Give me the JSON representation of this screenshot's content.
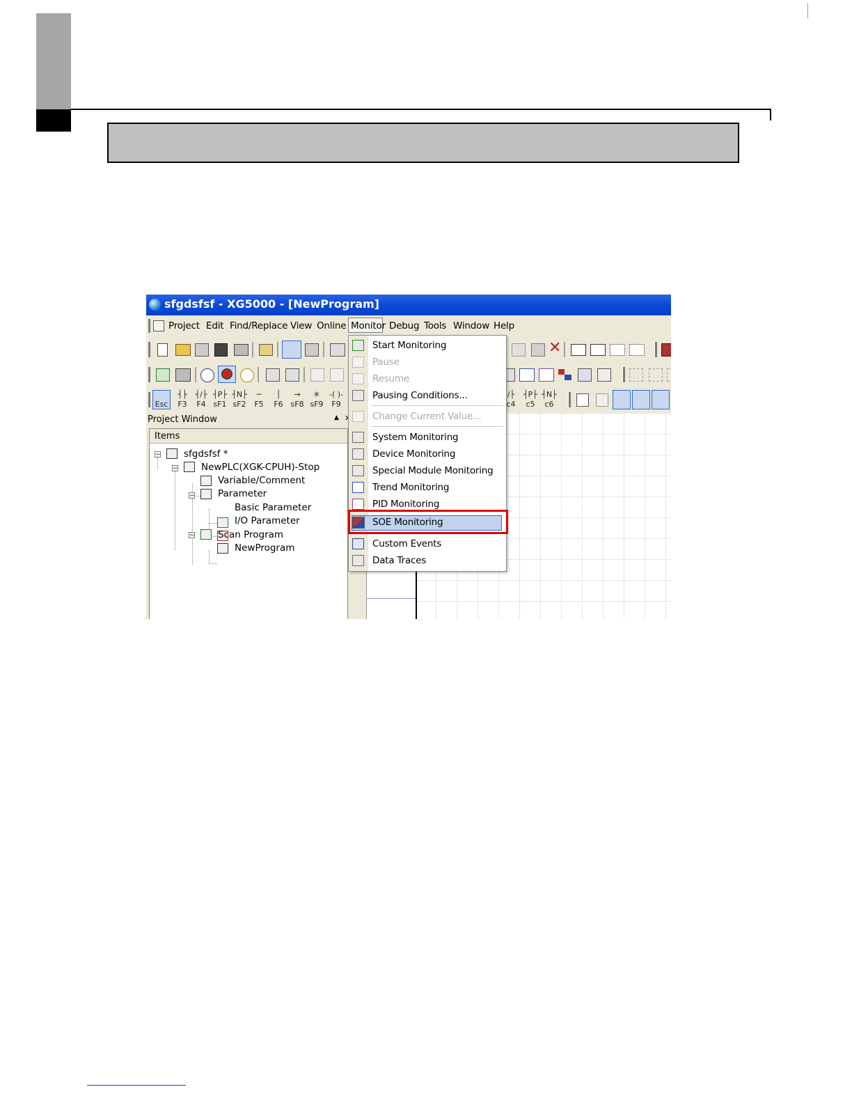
{
  "window": {
    "title": "sfgdsfsf - XG5000 - [NewProgram]"
  },
  "menubar": {
    "items": [
      "Project",
      "Edit",
      "Find/Replace",
      "View",
      "Online",
      "Monitor",
      "Debug",
      "Tools",
      "Window",
      "Help"
    ],
    "active": "Monitor"
  },
  "toolbar3": {
    "fkeys_left": [
      "Esc",
      "F3",
      "F4",
      "sF1",
      "sF2",
      "F5",
      "F6",
      "sF8",
      "sF9",
      "F9"
    ],
    "fkeys_right": [
      "c4",
      "c5",
      "c6"
    ]
  },
  "project_window": {
    "title": "Project Window",
    "column_header": "Items",
    "tree": [
      {
        "label": "sfgdsfsf *",
        "icon": "project-icon",
        "level": 0
      },
      {
        "label": "NewPLC(XGK-CPUH)-Stop",
        "icon": "plc-icon",
        "level": 1
      },
      {
        "label": "Variable/Comment",
        "icon": "variable-icon",
        "level": 2
      },
      {
        "label": "Parameter",
        "icon": "parameter-icon",
        "level": 2
      },
      {
        "label": "Basic Parameter",
        "icon": "basic-parameter-icon",
        "level": 3
      },
      {
        "label": "I/O Parameter",
        "icon": "io-parameter-icon",
        "level": 3
      },
      {
        "label": "Scan Program",
        "icon": "scan-program-icon",
        "level": 2
      },
      {
        "label": "NewProgram",
        "icon": "program-icon",
        "level": 3
      }
    ]
  },
  "monitor_menu": {
    "items": [
      {
        "label": "Start Monitoring",
        "enabled": true,
        "icon": "start-monitoring-icon"
      },
      {
        "label": "Pause",
        "enabled": false,
        "icon": "pause-icon"
      },
      {
        "label": "Resume",
        "enabled": false,
        "icon": "resume-icon"
      },
      {
        "label": "Pausing Conditions...",
        "enabled": true,
        "icon": "pausing-conditions-icon"
      },
      {
        "label": "Change Current Value...",
        "enabled": false,
        "icon": "change-value-icon"
      },
      {
        "label": "System Monitoring",
        "enabled": true,
        "icon": "system-monitoring-icon"
      },
      {
        "label": "Device Monitoring",
        "enabled": true,
        "icon": "device-monitoring-icon"
      },
      {
        "label": "Special Module Monitoring",
        "enabled": true,
        "icon": "special-module-icon"
      },
      {
        "label": "Trend Monitoring",
        "enabled": true,
        "icon": "trend-monitoring-icon"
      },
      {
        "label": "PID Monitoring",
        "enabled": true,
        "icon": "pid-monitoring-icon"
      },
      {
        "label": "SOE Monitoring",
        "enabled": true,
        "icon": "soe-monitoring-icon",
        "highlighted": true
      },
      {
        "label": "Custom Events",
        "enabled": true,
        "icon": "custom-events-icon"
      },
      {
        "label": "Data Traces",
        "enabled": true,
        "icon": "data-traces-icon"
      }
    ]
  },
  "colors": {
    "titlebar": "#0a4ad8",
    "highlight_box": "#e00000",
    "selection": "#c1d2ee"
  }
}
